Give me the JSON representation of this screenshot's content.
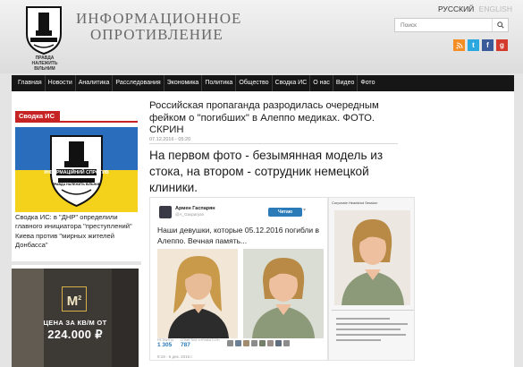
{
  "header": {
    "site_title_line1": "Информационное",
    "site_title_line2": "Опротивление",
    "logo_caption": "ПРАВДА НАЛЕЖИТЬ ВІЛЬНИМ",
    "lang_ru": "РУССКИЙ",
    "lang_en": "ENGLISH",
    "search_placeholder": "Поиск",
    "social": {
      "rss": "rss-icon",
      "twitter": "twitter-icon",
      "facebook": "facebook-icon",
      "google_plus": "google-plus-icon"
    }
  },
  "nav": [
    "Главная",
    "Новости",
    "Аналитика",
    "Расследования",
    "Экономика",
    "Политика",
    "Общество",
    "Сводка ИС",
    "О нас",
    "Видео",
    "Фото"
  ],
  "sidebar": {
    "widget_title": "Сводка ИС",
    "image_caption": "ІНФОРМАЦІЙНИЙ СПРОТИВ",
    "image_motto": "ПРАВДА НАЛЕЖИТЬ ВІЛЬНИМ",
    "news_text": "Сводка ИС: в \"ДНР\" определили главного инициатора \"преступлений\" Киева против \"мирных жителей Донбасса\"",
    "ad": {
      "logo": "M",
      "logo_sup": "2",
      "line1": "ЦЕНА ЗА КВ/М ОТ",
      "line2": "224.000 ₽"
    }
  },
  "article": {
    "title": "Российская пропаганда разродилась очередным фейком о \"погибших\" в Алеппо медиках. ФОТО. СКРИН",
    "date": "07.12.2016 - 05:20",
    "lead": "На первом фото - безымянная модель из стока, на втором - сотрудник немецкой клиники."
  },
  "tweet": {
    "author": "Армен Гаспарян",
    "handle": "@A_Gasparyan",
    "follow_label": "Читаю",
    "text": "Наши девушки, которые 05.12.2016 погибли в Алеппо. Вечная память...",
    "retweets_label": "РЕТВИТЫ",
    "retweets": "1 305",
    "likes_label": "ОТМЕТКИ «НРАВИТСЯ»",
    "likes": "787",
    "time": "9:19 - 6 дек. 2016 г."
  },
  "side_photo": {
    "caption": "Corporate Headshot Session"
  }
}
